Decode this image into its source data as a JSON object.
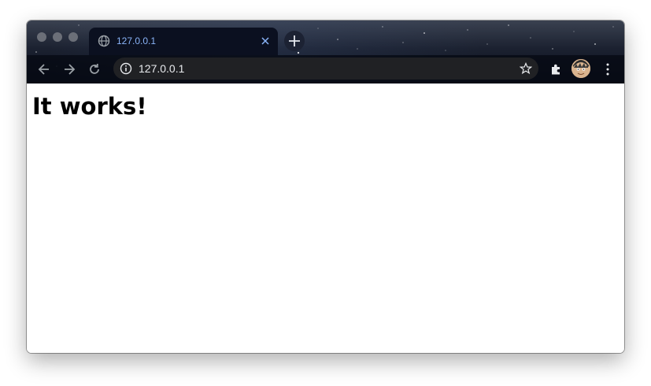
{
  "window": {
    "traffic_lights": [
      "close",
      "minimize",
      "zoom"
    ]
  },
  "tab": {
    "title": "127.0.0.1",
    "favicon": "globe-icon",
    "close_icon": "close-icon"
  },
  "new_tab": {
    "icon": "plus-icon"
  },
  "toolbar": {
    "back_icon": "arrow-left-icon",
    "forward_icon": "arrow-right-icon",
    "reload_icon": "reload-icon",
    "site_info_icon": "info-icon",
    "url": "127.0.0.1",
    "bookmark_icon": "star-icon",
    "extensions_icon": "puzzle-icon",
    "avatar": "profile-avatar",
    "menu_icon": "kebab-menu-icon"
  },
  "page": {
    "heading": "It works!"
  },
  "colors": {
    "tab_text": "#8ab4f8",
    "omnibox_bg": "#202124",
    "url_text": "#e8eaed",
    "page_bg": "#ffffff",
    "heading": "#000000"
  }
}
